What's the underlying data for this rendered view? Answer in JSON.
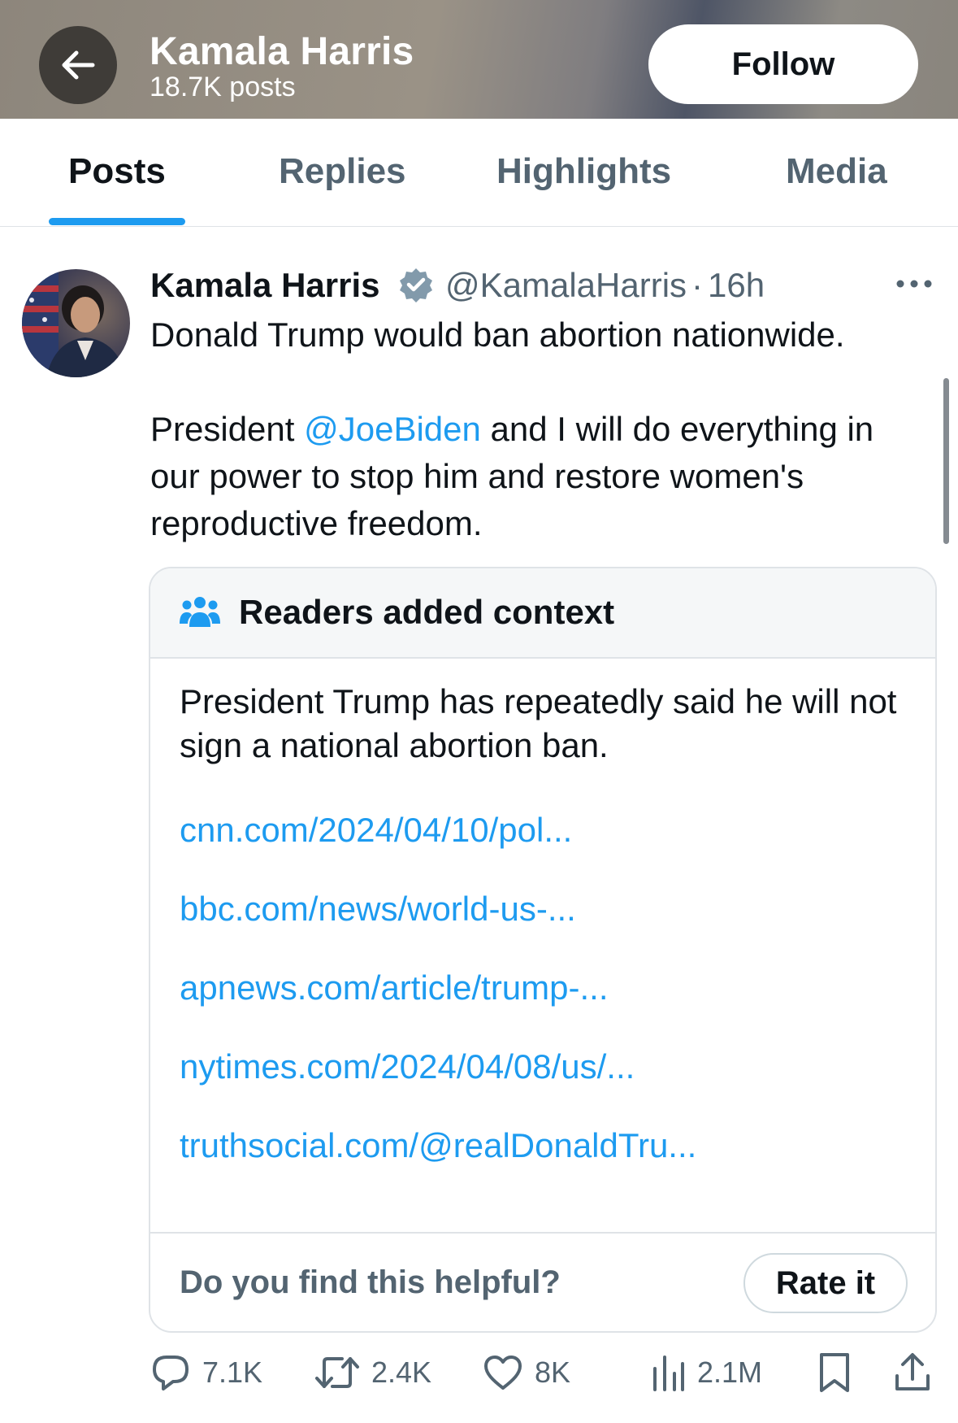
{
  "header": {
    "title": "Kamala Harris",
    "post_count": "18.7K posts",
    "follow_label": "Follow"
  },
  "tabs": [
    {
      "label": "Posts",
      "active": true
    },
    {
      "label": "Replies",
      "active": false
    },
    {
      "label": "Highlights",
      "active": false
    },
    {
      "label": "Media",
      "active": false
    }
  ],
  "post": {
    "author": "Kamala Harris",
    "verified": true,
    "handle": "@KamalaHarris",
    "separator": "·",
    "time": "16h",
    "text_line1": "Donald Trump would ban abortion nationwide.",
    "text_pre_mention": "President ",
    "mention": "@JoeBiden",
    "text_post_mention": " and I will do everything in our power to stop him and restore women's reproductive freedom."
  },
  "context_note": {
    "title": "Readers added context",
    "text": "President Trump has repeatedly said he will not sign a national abortion ban.",
    "links": [
      "cnn.com/2024/04/10/pol...",
      "bbc.com/news/world-us-...",
      "apnews.com/article/trump-...",
      "nytimes.com/2024/04/08/us/...",
      "truthsocial.com/@realDonaldTru..."
    ],
    "helpful_question": "Do you find this helpful?",
    "rate_label": "Rate it"
  },
  "actions": {
    "replies": "7.1K",
    "reposts": "2.4K",
    "likes": "8K",
    "views": "2.1M"
  },
  "colors": {
    "accent": "#1d9bf0",
    "text_primary": "#0f1419",
    "text_secondary": "#536471",
    "border": "#dfe3e7"
  },
  "icons": [
    "back-arrow-icon",
    "verified-badge-icon",
    "more-icon",
    "people-icon",
    "reply-icon",
    "repost-icon",
    "like-icon",
    "views-icon",
    "bookmark-icon",
    "share-icon"
  ]
}
